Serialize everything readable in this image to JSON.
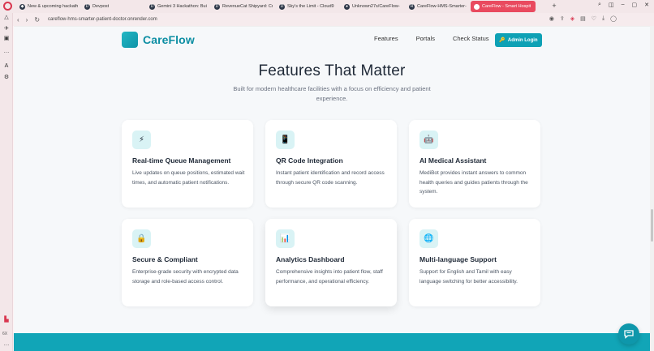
{
  "browser": {
    "tabs": [
      {
        "label": "New & upcoming hackath",
        "icon": "hackathon-icon"
      },
      {
        "label": "Devpost",
        "icon": "devpost-icon"
      },
      {
        "label": "Gemini 3 Hackathon: Bui",
        "icon": "devpost-icon"
      },
      {
        "label": "RevenueCat Shipyard: Cr",
        "icon": "devpost-icon"
      },
      {
        "label": "Sky's the Limit - Cloud9",
        "icon": "devpost-icon"
      },
      {
        "label": "Unknown27s/CareFlow-",
        "icon": "github-icon"
      },
      {
        "label": "CareFlow-HMS-Smarter-",
        "icon": "render-icon"
      },
      {
        "label": "CareFlow - Smart Hospit",
        "icon": "careflow-icon",
        "active": true
      }
    ],
    "url": "careflow-hms-smarter-patient-doctor.onrender.com",
    "sidebar_bottom_label": "6X"
  },
  "header": {
    "brand": "CareFlow",
    "nav": [
      "Features",
      "Portals",
      "Check Status"
    ],
    "admin_button": "Admin Login"
  },
  "section": {
    "title": "Features That Matter",
    "subtitle": "Built for modern healthcare facilities with a focus on efficiency and patient experience."
  },
  "features": [
    {
      "icon": "lightning-icon",
      "glyph": "⚡",
      "title": "Real-time Queue Management",
      "description": "Live updates on queue positions, estimated wait times, and automatic patient notifications."
    },
    {
      "icon": "phone-icon",
      "glyph": "📱",
      "title": "QR Code Integration",
      "description": "Instant patient identification and record access through secure QR code scanning."
    },
    {
      "icon": "robot-icon",
      "glyph": "🤖",
      "title": "AI Medical Assistant",
      "description": "MediBot provides instant answers to common health queries and guides patients through the system."
    },
    {
      "icon": "lock-icon",
      "glyph": "🔒",
      "title": "Secure & Compliant",
      "description": "Enterprise-grade security with encrypted data storage and role-based access control."
    },
    {
      "icon": "bar-chart-icon",
      "glyph": "📊",
      "title": "Analytics Dashboard",
      "description": "Comprehensive insights into patient flow, staff performance, and operational efficiency."
    },
    {
      "icon": "globe-icon",
      "glyph": "🌐",
      "title": "Multi-language Support",
      "description": "Support for English and Tamil with easy language switching for better accessibility."
    }
  ]
}
